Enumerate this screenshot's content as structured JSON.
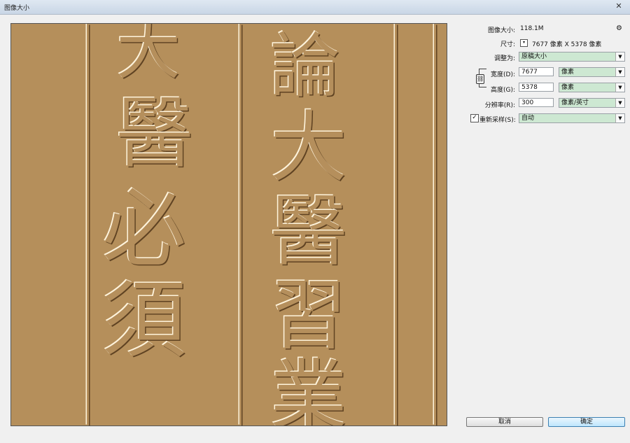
{
  "window": {
    "title": "图像大小",
    "close_glyph": "✕"
  },
  "preview": {
    "glyphs": [
      "大",
      "醫",
      "必",
      "須",
      "論",
      "大",
      "醫",
      "習",
      "業"
    ]
  },
  "panel": {
    "image_size_label": "图像大小:",
    "image_size_value": "118.1M",
    "dimensions_label": "尺寸:",
    "dimensions_value": "7677 像素  X  5378 像素",
    "fit_to_label": "调整为:",
    "fit_to_value": "原稿大小",
    "width_label": "宽度(D):",
    "width_value": "7677",
    "width_unit": "像素",
    "height_label": "高度(G):",
    "height_value": "5378",
    "height_unit": "像素",
    "resolution_label": "分辨率(R):",
    "resolution_value": "300",
    "resolution_unit": "像素/英寸",
    "resample_label": "重新采样(S):",
    "resample_checked": "✓",
    "resample_value": "自动"
  },
  "buttons": {
    "cancel": "取消",
    "ok": "确定"
  },
  "icons": {
    "gear": "gear-icon",
    "link": "link-icon",
    "close": "close-icon",
    "arrow": "chevron-down-icon"
  }
}
